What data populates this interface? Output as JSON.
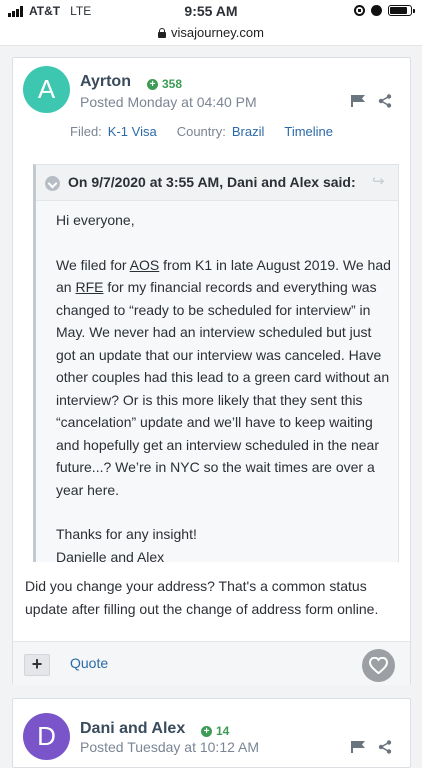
{
  "status_bar": {
    "carrier": "AT&T",
    "network": "LTE",
    "time": "9:55 AM"
  },
  "browser": {
    "url": "visajourney.com"
  },
  "post": {
    "avatar_letter": "A",
    "author": "Ayrton",
    "reputation": "358",
    "posted": "Posted Monday at 04:40 PM",
    "filed_label": "Filed:",
    "filed_value": "K-1 Visa",
    "country_label": "Country:",
    "country_value": "Brazil",
    "timeline_link": "Timeline",
    "quote": {
      "cite": "On 9/7/2020 at 3:55 AM, Dani and Alex said:",
      "greeting": "Hi everyone,",
      "p1_a": "We filed for ",
      "p1_aos": "AOS",
      "p1_b": " from K1 in late August 2019. We had an ",
      "p1_rfe": "RFE",
      "p1_c": " for my financial records and everything was changed to “ready to be scheduled for interview” in May. We never had an interview scheduled but just got an update that our interview was canceled. Have other couples had this lead to a green card without an interview? Or is this more likely that they sent this “cancelation” update and we’ll have to keep waiting and hopefully get an interview scheduled in the near future...? We’re in NYC so the wait times are over a year here.",
      "thanks": "Thanks for any insight!",
      "signature": "Danielle and Alex"
    },
    "reply": "Did you change your address? That's a common status update after filling out the change of address form online.",
    "footer": {
      "plus": "+",
      "quote_label": "Quote"
    }
  },
  "post2": {
    "avatar_letter": "D",
    "author": "Dani and Alex",
    "reputation": "14",
    "posted": "Posted Tuesday at 10:12 AM"
  },
  "colors": {
    "accent_link": "#2b6aa8",
    "reputation_green": "#3e9b55",
    "avatar_a": "#3ec7b0",
    "avatar_d": "#7a55c9"
  },
  "icons": [
    "signal-icon",
    "padlock-icon",
    "flag-icon",
    "share-icon",
    "chevron-down-icon",
    "reply-arrow-icon",
    "heart-icon"
  ]
}
